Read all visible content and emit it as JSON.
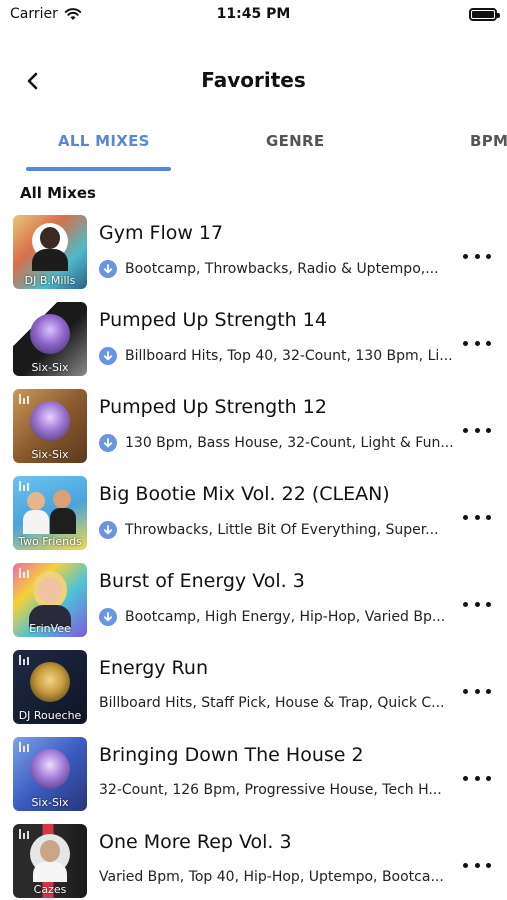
{
  "status_bar": {
    "carrier": "Carrier",
    "time": "11:45 PM"
  },
  "nav": {
    "title": "Favorites",
    "back_icon": "chevron-left-icon"
  },
  "tabs": [
    {
      "label": "ALL MIXES",
      "active": true
    },
    {
      "label": "GENRE",
      "active": false
    },
    {
      "label": "BPM",
      "active": false
    }
  ],
  "colors": {
    "accent": "#5b86d8",
    "download_badge": "#6b94e2"
  },
  "section_title": "All Mixes",
  "mixes": [
    {
      "title": "Gym Flow 17",
      "tags": "Bootcamp, Throwbacks, Radio & Uptempo,...",
      "downloaded": true,
      "artist": "DJ B.Mills"
    },
    {
      "title": "Pumped Up Strength 14",
      "tags": "Billboard Hits, Top 40, 32-Count, 130 Bpm, Li...",
      "downloaded": true,
      "artist": "Six-Six"
    },
    {
      "title": "Pumped Up Strength 12",
      "tags": "130 Bpm, Bass House, 32-Count, Light & Fun...",
      "downloaded": true,
      "artist": "Six-Six"
    },
    {
      "title": "Big Bootie Mix Vol. 22 (CLEAN)",
      "tags": "Throwbacks, Little Bit Of Everything, Super...",
      "downloaded": true,
      "artist": "Two Friends"
    },
    {
      "title": "Burst of Energy Vol. 3",
      "tags": "Bootcamp, High Energy, Hip-Hop, Varied Bp...",
      "downloaded": true,
      "artist": "ErinVee"
    },
    {
      "title": "Energy Run",
      "tags": "Billboard Hits, Staff Pick, House & Trap, Quick C...",
      "downloaded": false,
      "artist": "DJ Roueche"
    },
    {
      "title": "Bringing Down The House 2",
      "tags": "32-Count, 126 Bpm, Progressive House, Tech H...",
      "downloaded": false,
      "artist": "Six-Six"
    },
    {
      "title": "One More Rep Vol. 3",
      "tags": "Varied Bpm, Top 40, Hip-Hop, Uptempo, Bootca...",
      "downloaded": false,
      "artist": "Cazes"
    }
  ]
}
